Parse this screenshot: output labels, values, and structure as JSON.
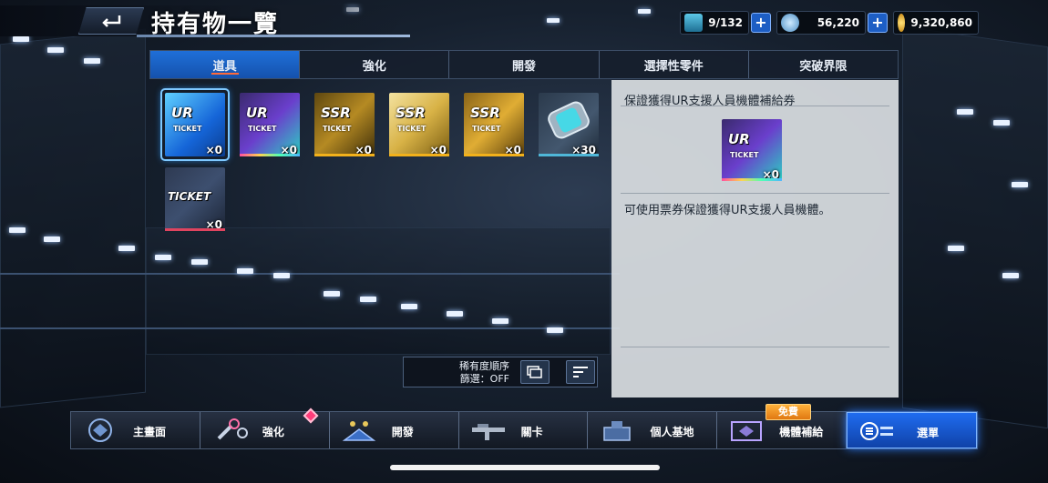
{
  "header": {
    "title": "持有物一覽"
  },
  "currencies": [
    {
      "icon": "pilot-capacity-icon",
      "value": "9/132"
    },
    {
      "icon": "gem-icon",
      "value": "56,220"
    },
    {
      "icon": "coin-icon",
      "value": "9,320,860"
    }
  ],
  "tabs": [
    {
      "label": "道具",
      "active": true
    },
    {
      "label": "強化",
      "active": false
    },
    {
      "label": "開發",
      "active": false
    },
    {
      "label": "選擇性零件",
      "active": false
    },
    {
      "label": "突破界限",
      "active": false
    }
  ],
  "items": [
    {
      "name": "ur-ticket-blue",
      "label": "UR",
      "sub": "TICKET",
      "count": "×0",
      "color": "#1e8ef0"
    },
    {
      "name": "ur-ticket-rainbow",
      "label": "UR",
      "sub": "TICKET",
      "count": "×0",
      "color": "#7a3fd6"
    },
    {
      "name": "ssr-ticket-gold-1",
      "label": "SSR",
      "sub": "TICKET",
      "count": "×0",
      "color": "#b6861c"
    },
    {
      "name": "ssr-ticket-gold-2",
      "label": "SSR",
      "sub": "TICKET",
      "count": "×0",
      "color": "#d4a62a"
    },
    {
      "name": "ssr-ticket-gold-3",
      "label": "SSR",
      "sub": "TICKET",
      "count": "×0",
      "color": "#c48f1e"
    },
    {
      "name": "canister-item",
      "label": "",
      "sub": "",
      "count": "×30",
      "color": "#4fb7d8"
    },
    {
      "name": "ticket-red",
      "label": "TICKET",
      "sub": "",
      "count": "×0",
      "color": "#c7415a"
    }
  ],
  "detail": {
    "title": "保證獲得UR支援人員機體補給券",
    "icon_label": "UR",
    "icon_sub": "TICKET",
    "icon_count": "×0",
    "description": "可使用票券保證獲得UR支援人員機體。"
  },
  "sort": {
    "line1": "稀有度順序",
    "line2": "篩選：OFF"
  },
  "nav": [
    {
      "label": "主畫面",
      "icon": "home-emblem-icon",
      "active": false
    },
    {
      "label": "強化",
      "icon": "wrench-icon",
      "active": false
    },
    {
      "label": "開發",
      "icon": "development-icon",
      "active": false
    },
    {
      "label": "關卡",
      "icon": "rifle-icon",
      "active": false
    },
    {
      "label": "個人基地",
      "icon": "base-icon",
      "active": false
    },
    {
      "label": "機體補給",
      "icon": "supply-icon",
      "active": false
    },
    {
      "label": "選單",
      "icon": "menu-icon",
      "active": true
    }
  ],
  "free_badge": "免費"
}
